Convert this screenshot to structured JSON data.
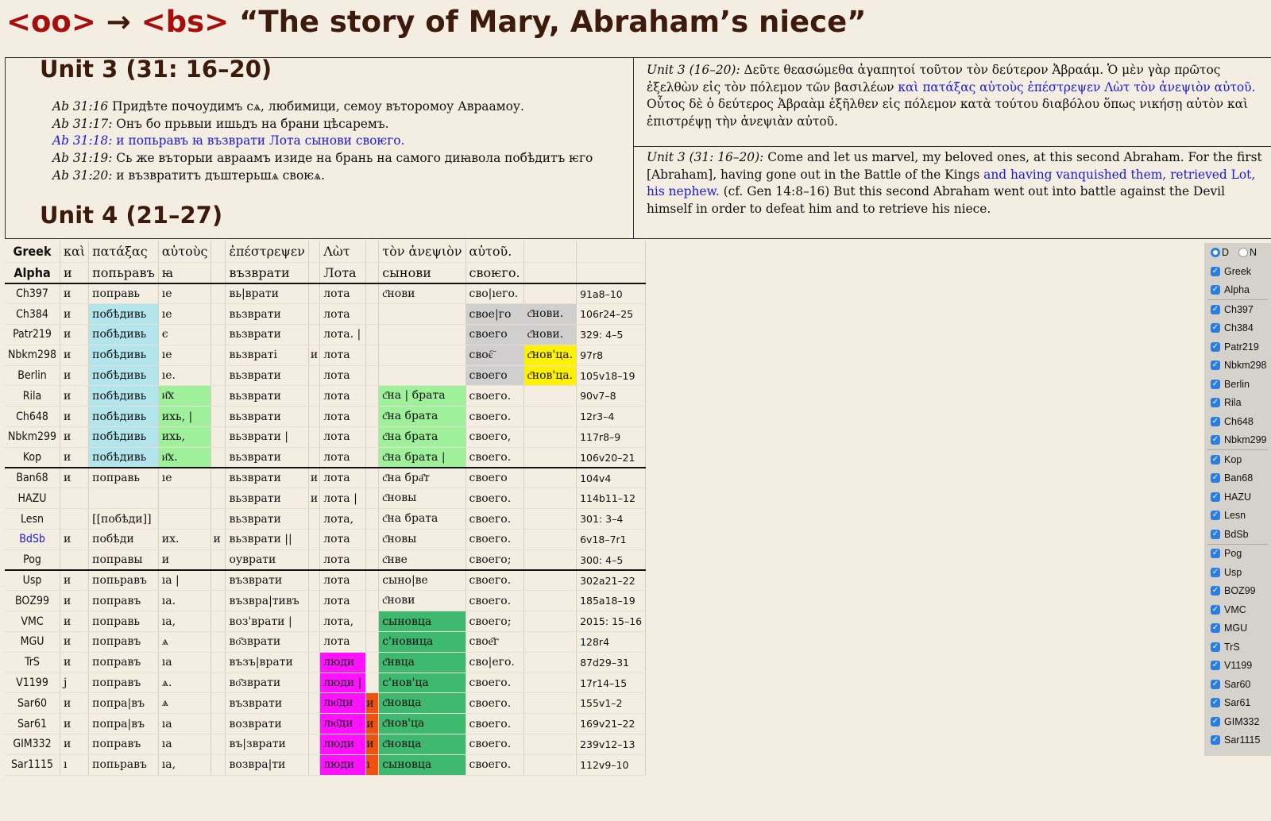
{
  "title": {
    "tag1": "<oo>",
    "arrow": " → ",
    "tag2": "<bs>",
    "text": " “The story of Mary, Abraham’s niece”"
  },
  "unit3_heading": "Unit 3 (31: 16–20)",
  "unit4_heading": "Unit 4 (21–27)",
  "ab_lines": [
    {
      "ref": "Ab 31:16",
      "text": " Придѣте почоудимъ сѧ, любимици, семоу въторомоу Авраамоу."
    },
    {
      "ref": "Ab 31:17:",
      "text": " Онъ бо прьвыи ишьдъ на брани цѣсаремъ."
    },
    {
      "ref": "Ab 31:18:",
      "text": " и попьравъ ꙗ възврати Лота сынови своѥго."
    },
    {
      "ref": "Ab 31:19:",
      "text": " Сь же въторыи авраамъ изиде на брань на самого диꙗвола побѣдитъ ѥго"
    },
    {
      "ref": "Ab 31:20:",
      "text": " и възвратитъ дъштерьшѧ своѥѧ."
    }
  ],
  "greek": {
    "ref": "Unit 3 (16–20):",
    "part1": " Δεῦτε θεασώμεθα ἀγαπητοί τοῦτον τὸν δεύτερον Ἀβραάμ. Ὁ μὲν γὰρ πρῶτος ἐξελθὼν εἰς τὸν πόλεμον τῶν βασιλέων ",
    "blue": "καὶ πατάξας αὐτοὺς ἐπέστρεψεν Λὼτ τὸν ἀνεψιὸν αὐτοῦ.",
    "part2": " Οὗτος δὲ ὁ δεύτερος Ἀβραὰμ ἐξῆλθεν εἰς πόλεμον κατὰ τούτου διαβόλου ὅπως νικήσῃ αὐτὸν καὶ ἐπιστρέψῃ τὴν ἀνεψιὰν αὐτοῦ."
  },
  "english": {
    "ref": "Unit 3 (31: 16–20):",
    "part1": " Come and let us marvel, my beloved ones, at this second Abraham. For the first [Abraham], having gone out in the Battle of the Kings ",
    "blue": "and having vanquished them, retrieved Lot, his nephew.",
    "part2": " (cf. Gen 14:8–16) But this second Abraham went out into battle against the Devil himself in order to defeat him and to retrieve his niece."
  },
  "table": {
    "header": [
      "Greek",
      "καὶ",
      "πατάξας",
      "αὐτοὺς",
      "",
      "ἐπέστρεψεν",
      "",
      "Λὼτ",
      "",
      "τὸν ἀνεψιὸν",
      "αὐτοῦ.",
      "",
      ""
    ],
    "alpha": [
      "Alpha",
      "и",
      "попьравъ",
      "ꙗ",
      "",
      "възврати",
      "",
      "Лота",
      "",
      "сынови",
      "своѥго.",
      "",
      ""
    ],
    "rows": [
      [
        "Ch397",
        "и",
        "поправь",
        "ıе",
        "",
        "вь|врати",
        "",
        "лота",
        "",
        "с҃нови",
        "сво|ıего.",
        "",
        "91а8–10"
      ],
      [
        "Ch384",
        "и",
        "побѣдивь",
        "ıе",
        "",
        "вьзврати",
        "",
        "лота",
        "",
        "",
        "свое|го",
        "с҃нови.",
        "106r24–25"
      ],
      [
        "Patr219",
        "и",
        "побѣдивь",
        "є",
        "",
        "вьзврати",
        "",
        "лота. |",
        "",
        "",
        "своего",
        "с҃нови.",
        "329: 4–5"
      ],
      [
        "Nbkm298",
        "и",
        "побѣдивь",
        "ıе",
        "",
        "вьзвраті",
        "и",
        "лота",
        "",
        "",
        "своє҇",
        "с҃нов'ца.",
        "97r8"
      ],
      [
        "Berlin",
        "и",
        "побѣдивь",
        "ıе.",
        "",
        "вьзврати",
        "",
        "лота",
        "",
        "",
        "своего",
        "с҃нов'ца.",
        "105v18–19"
      ],
      [
        "Rila",
        "и",
        "побѣдивь",
        "и҃х",
        "",
        "вьзврати",
        "",
        "лота",
        "",
        "с҃на | брата",
        "своего.",
        "",
        "90v7–8"
      ],
      [
        "Ch648",
        "и",
        "побѣдивь",
        "ихь, |",
        "",
        "вьзврати",
        "",
        "лота",
        "",
        "с҃на брата",
        "своего.",
        "",
        "12r3–4"
      ],
      [
        "Nbkm299",
        "и",
        "побѣдивь",
        "ихь,",
        "",
        "вьзврати |",
        "",
        "лота",
        "",
        "с҃на брата",
        "своего,",
        "",
        "117r8–9"
      ],
      [
        "Kop",
        "и",
        "побѣдивь",
        "и҃х.",
        "",
        "вьзврати",
        "",
        "лота",
        "",
        "с҃на брата |",
        "своего.",
        "",
        "106v20–21"
      ],
      [
        "Ban68",
        "и",
        "поправь",
        "ıе",
        "",
        "вьзврати",
        "и",
        "лота",
        "",
        "с҃на бра҃т",
        "своего",
        "",
        "104v4"
      ],
      [
        "HAZU",
        "",
        "",
        "",
        "",
        "вьзврати",
        "и",
        "лота |",
        "",
        "с҃новы",
        "своего.",
        "",
        "114b11–12"
      ],
      [
        "Lesn",
        "",
        "[[побѣди]]",
        "",
        "",
        "вьзврати",
        "",
        "лота,",
        "",
        "с҃на брата",
        "своего.",
        "",
        "301: 3–4"
      ],
      [
        "BdSb",
        "и",
        "побѣди",
        "их.",
        "и",
        "вьзврати ||",
        "",
        "лота",
        "",
        "с҃новы",
        "своего.",
        "",
        "6v18–7r1"
      ],
      [
        "Pog",
        "",
        "поправы",
        "и",
        "",
        "оуврати",
        "",
        "лота",
        "",
        "с҃нве",
        "своего;",
        "",
        "300: 4–5"
      ],
      [
        "Usp",
        "и",
        "попьравъ",
        "ıа |",
        "",
        "възврати",
        "",
        "лота",
        "",
        "сыно|ве",
        "своего.",
        "",
        "302а21–22"
      ],
      [
        "BOZ99",
        "и",
        "поправъ",
        "ıа.",
        "",
        "възвра|тивъ",
        "",
        "лота",
        "",
        "с҃нови",
        "своего.",
        "",
        "185а18–19"
      ],
      [
        "VMC",
        "и",
        "поправь",
        "ıа,",
        "",
        "воз'врати |",
        "",
        "лота,",
        "",
        "сыновца",
        "своего;",
        "",
        "2015: 15–16"
      ],
      [
        "MGU",
        "и",
        "поправъ",
        "ѧ",
        "",
        "во҃зврати",
        "",
        "лота",
        "",
        "с'новица",
        "свое҃г",
        "",
        "128r4"
      ],
      [
        "TrS",
        "и",
        "поправъ",
        "ıа",
        "",
        "възъ|врати",
        "",
        "люди",
        "",
        "с҃нвца",
        "сво|его.",
        "",
        "87d29–31"
      ],
      [
        "V1199",
        "j",
        "поправъ",
        "ѧ.",
        "",
        "во҃зврати",
        "",
        "люди |",
        "",
        "с'нов'ца",
        "своего.",
        "",
        "17r14–15"
      ],
      [
        "Sar60",
        "и",
        "попра|въ",
        "ѧ",
        "",
        "възврати",
        "",
        "лю҃ди",
        "и",
        "с҃новца",
        "своего.",
        "",
        "155v1–2"
      ],
      [
        "Sar61",
        "и",
        "попра|въ",
        "ıа",
        "",
        "возврати",
        "",
        "лю҃ди",
        "и",
        "с҃нов'ца",
        "своего.",
        "",
        "169v21–22"
      ],
      [
        "GIM332",
        "и",
        "поправъ",
        "ıа",
        "",
        "въ|зврати",
        "",
        "люди",
        "и",
        "с҃новца",
        "своего.",
        "",
        "239v12–13"
      ],
      [
        "Sar1115",
        "ı",
        "попьравъ",
        "ıа,",
        "",
        "возвра|ти",
        "",
        "люди",
        "ı",
        "сыновца",
        "своего.",
        "",
        "112v9–10"
      ]
    ],
    "highlights": {
      "cyan": "#b2e6ec",
      "lightgreen": "#9ff09a",
      "darkgreen": "#3fb870",
      "gray": "#cfcfcf",
      "yellow": "#fff200",
      "magenta": "#ff12ff",
      "orange": "#f05010"
    }
  },
  "sidebar": {
    "radio_d": "D",
    "radio_n": "N",
    "groups": [
      [
        "Greek",
        "Alpha"
      ],
      [
        "Ch397",
        "Ch384",
        "Patr219",
        "Nbkm298",
        "Berlin",
        "Rila",
        "Ch648",
        "Nbkm299"
      ],
      [
        "Kop",
        "Ban68",
        "HAZU",
        "Lesn",
        "BdSb"
      ],
      [
        "Pog",
        "Usp",
        "BOZ99",
        "VMC",
        "MGU",
        "TrS",
        "V1199",
        "Sar60",
        "Sar61",
        "GIM332",
        "Sar1115"
      ]
    ]
  }
}
